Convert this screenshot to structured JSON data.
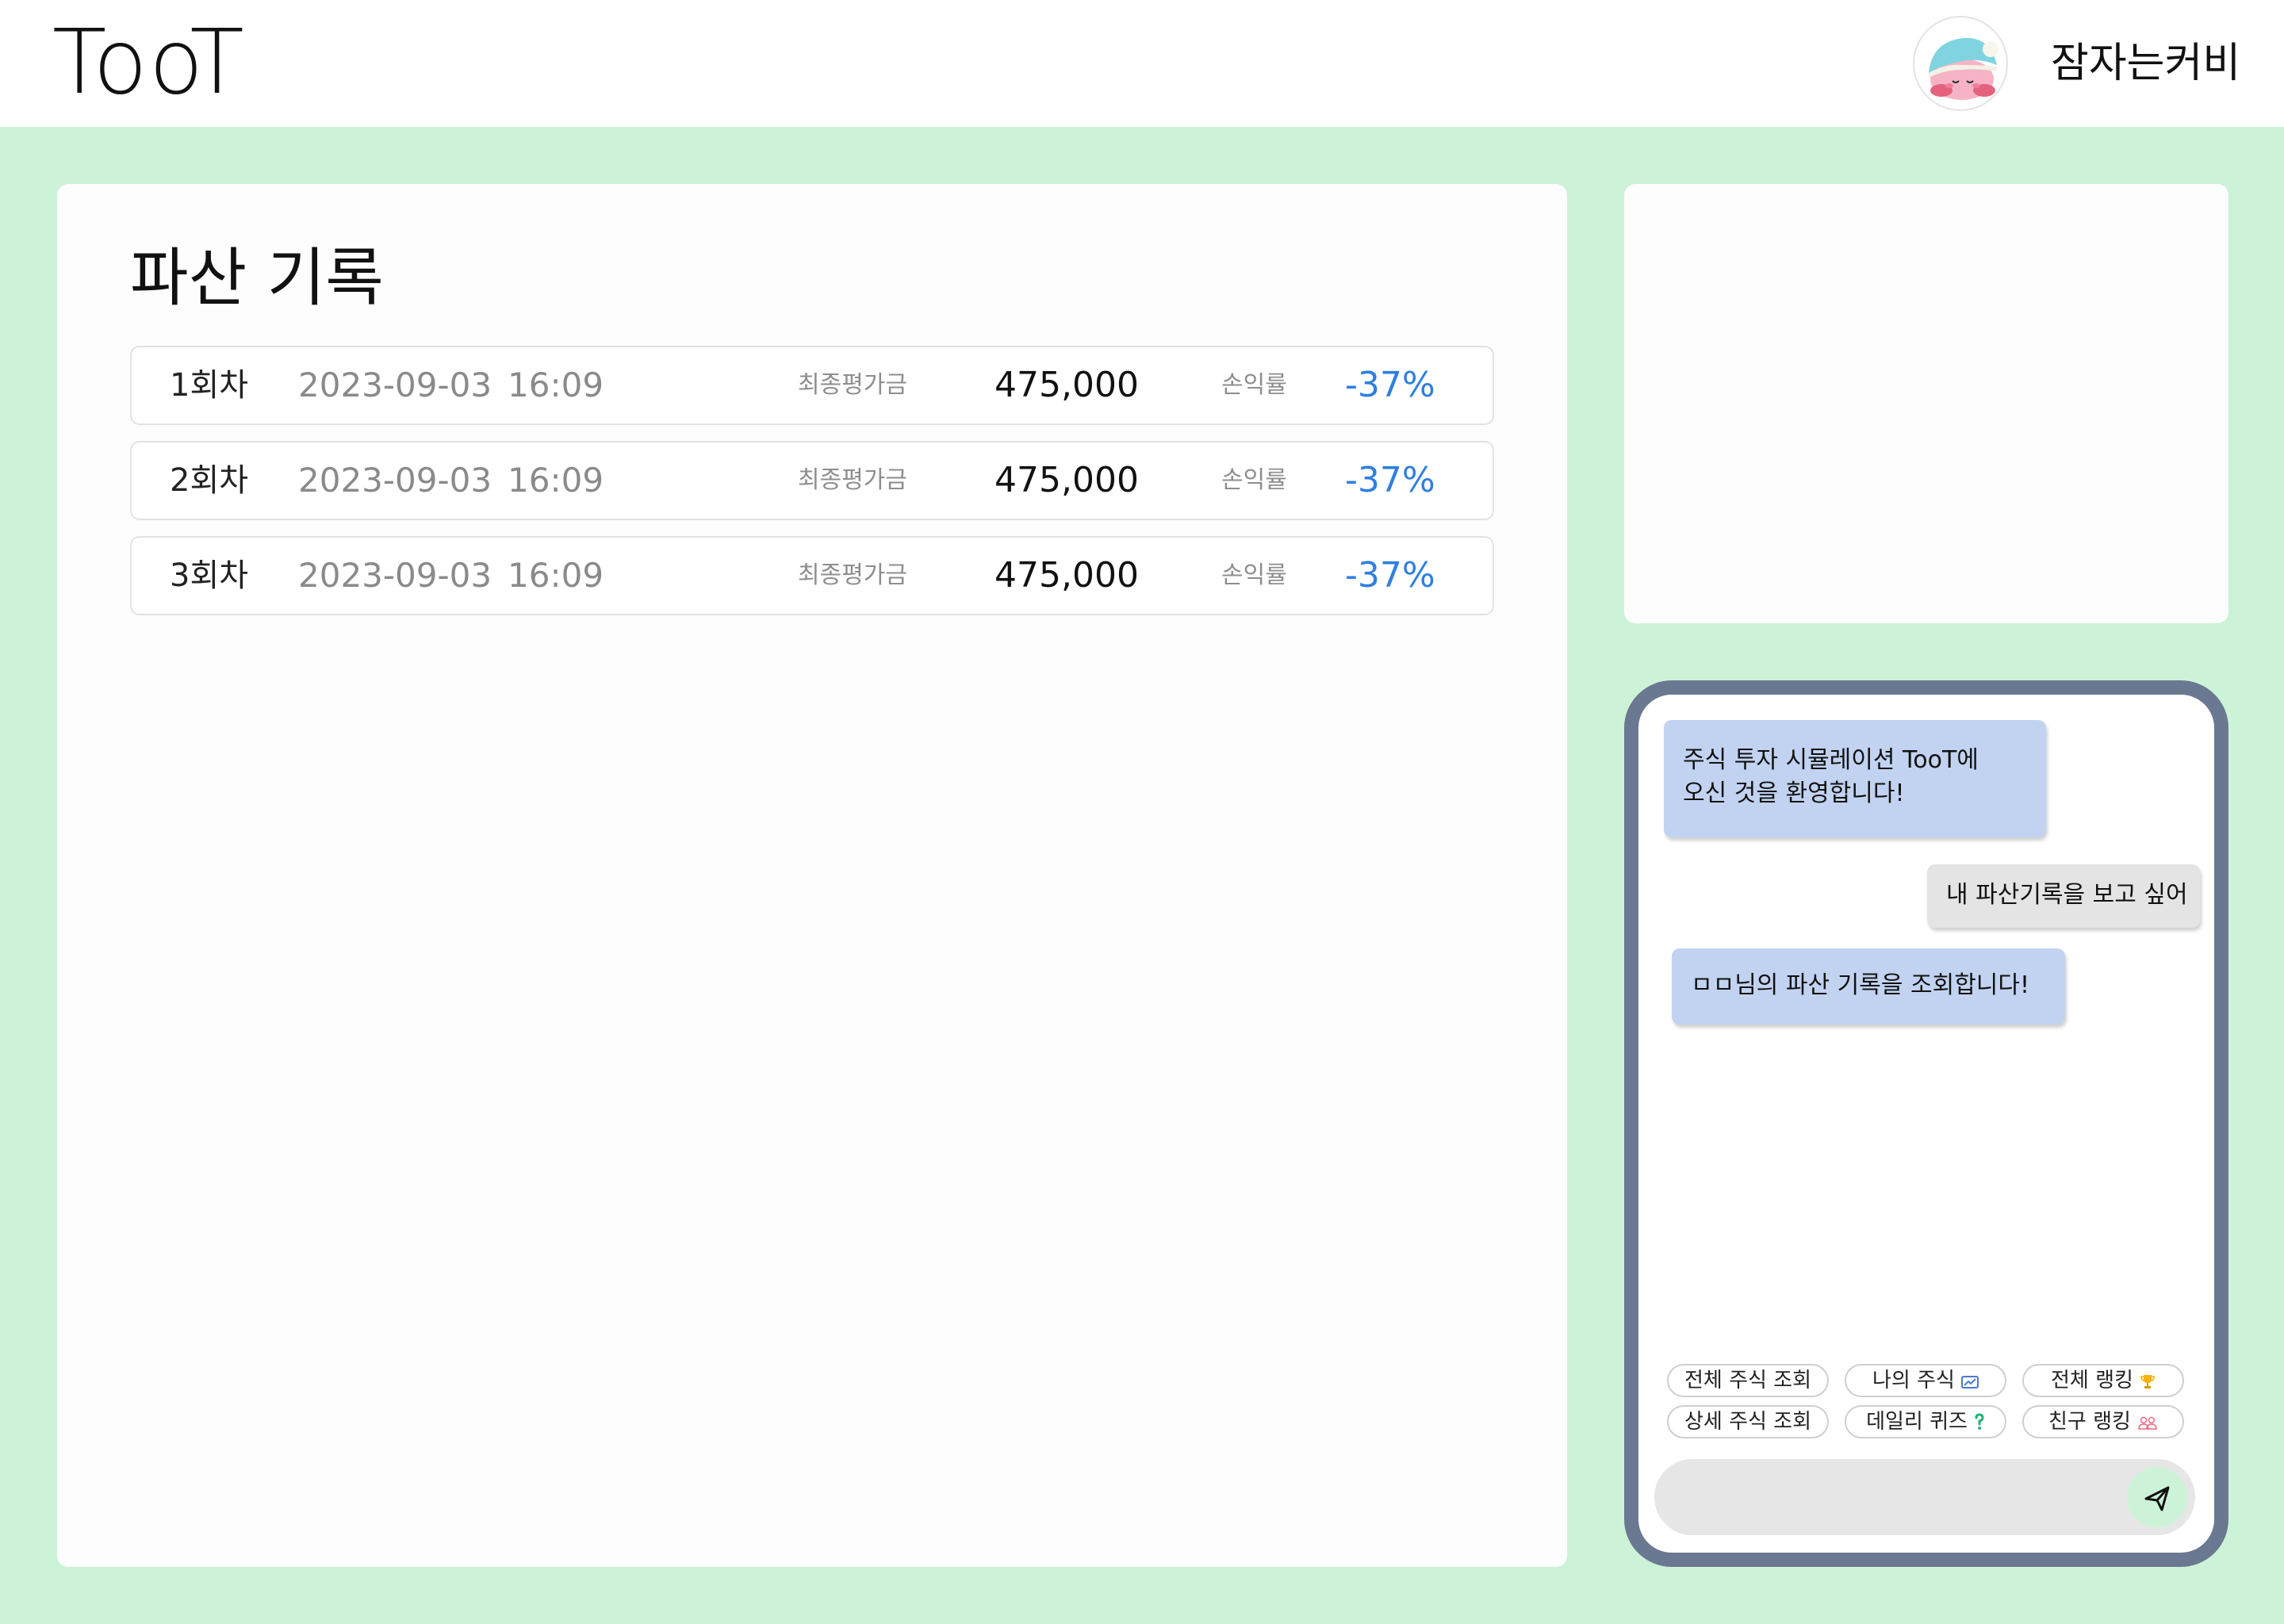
{
  "header": {
    "logo": "TooT",
    "username": "잠자는커비"
  },
  "main": {
    "title": "파산 기록",
    "records": [
      {
        "round": "1회차",
        "date": "2023-09-03",
        "time": "16:09",
        "final_label": "최종평가금",
        "final_value": "475,000",
        "pl_label": "손익률",
        "pl_rate": "-37%"
      },
      {
        "round": "2회차",
        "date": "2023-09-03",
        "time": "16:09",
        "final_label": "최종평가금",
        "final_value": "475,000",
        "pl_label": "손익률",
        "pl_rate": "-37%"
      },
      {
        "round": "3회차",
        "date": "2023-09-03",
        "time": "16:09",
        "final_label": "최종평가금",
        "final_value": "475,000",
        "pl_label": "손익률",
        "pl_rate": "-37%"
      }
    ]
  },
  "chat": {
    "messages": [
      {
        "sender": "bot",
        "lines": [
          "주식 투자 시뮬레이션 TooT에",
          "오신 것을 환영합니다!"
        ]
      },
      {
        "sender": "user",
        "lines": [
          "내 파산기록을 보고 싶어"
        ]
      },
      {
        "sender": "bot",
        "lines": [
          "ㅁㅁ님의 파산 기록을 조회합니다!"
        ]
      }
    ],
    "quick_buttons": [
      {
        "label": "전체 주식 조회",
        "icon": ""
      },
      {
        "label": "나의 주식",
        "icon": "chart-icon"
      },
      {
        "label": "전체 랭킹",
        "icon": "trophy-icon"
      },
      {
        "label": "상세 주식 조회",
        "icon": ""
      },
      {
        "label": "데일리 퀴즈",
        "icon": "question-icon"
      },
      {
        "label": "친구 랭킹",
        "icon": "friends-icon"
      }
    ],
    "input_placeholder": "",
    "send_icon": "paper-plane-icon"
  },
  "colors": {
    "background": "#ccf3d7",
    "accent_rate": "#2f7fe0",
    "bot_bubble": "#c2d3f1",
    "user_bubble": "#e4e4e4",
    "chat_border": "#6b7891"
  }
}
